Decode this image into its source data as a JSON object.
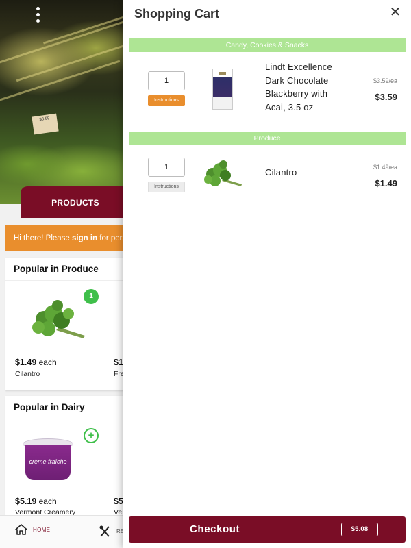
{
  "background": {
    "hero_price_tag": "$3.99",
    "products_tab_label": "PRODUCTS",
    "signin_banner": {
      "prefix": "Hi there! Please ",
      "link": "sign in",
      "suffix": " for perso"
    },
    "popular_produce": {
      "title": "Popular in Produce",
      "badge": "1",
      "item": {
        "price": "$1.49",
        "unit": "each",
        "name": "Cilantro"
      },
      "next_price_partial": "$1",
      "next_name_partial": "Fre"
    },
    "popular_dairy": {
      "title": "Popular in Dairy",
      "badge": "+",
      "tub_label": "crème fraîche",
      "item": {
        "price": "$5.19",
        "unit": "each",
        "name": "Vermont Creamery"
      },
      "next_price_partial": "$5",
      "next_name_partial": "Ver"
    },
    "bottom_nav": {
      "home_label": "HOME",
      "recipes_label_partial": "RE"
    }
  },
  "cart": {
    "title": "Shopping Cart",
    "close_icon": "close-icon",
    "sections": [
      {
        "category": "Candy, Cookies & Snacks",
        "item": {
          "quantity": "1",
          "instructions_label": "Instructions",
          "name_lines": [
            "Lindt Excellence",
            "Dark Chocolate",
            "Blackberry with",
            "Acai, 3.5 oz"
          ],
          "unit_price": "$3.59/ea",
          "line_price": "$3.59"
        }
      },
      {
        "category": "Produce",
        "item": {
          "quantity": "1",
          "instructions_label": "Instructions",
          "name_lines": [
            "Cilantro"
          ],
          "unit_price": "$1.49/ea",
          "line_price": "$1.49"
        }
      }
    ],
    "checkout": {
      "label": "Checkout",
      "total": "$5.08"
    }
  },
  "colors": {
    "brand": "#7a0d26",
    "accent_orange": "#e98e2d",
    "category_green": "#aee594",
    "badge_green": "#3fbf4a"
  }
}
